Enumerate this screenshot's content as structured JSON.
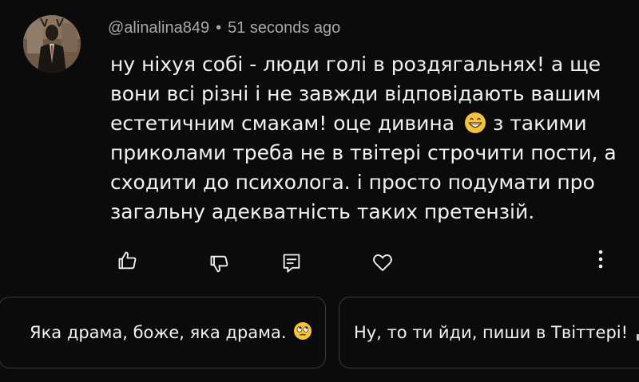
{
  "comment": {
    "username": "@alinalina849",
    "separator": "•",
    "time": "51 seconds ago",
    "lines": [
      "ну ніхуя собі - люди голі в роздягальнях! а ще",
      "вони всі різні і не завжди відповідають вашим",
      "естетичним смакам! оце дивина",
      "з такими",
      "приколами треба не в твітері строчити пости, а",
      "сходити до психолога. і просто подумати про",
      "загальну адекватність таких претензій."
    ],
    "emoji": "grinning-face-emoji"
  },
  "actions": {
    "like_icon": "thumbs-up-icon",
    "dislike_icon": "thumbs-down-icon",
    "reply_icon": "reply-comment-icon",
    "heart_icon": "heart-icon",
    "more_icon": "more-vertical-icon"
  },
  "suggestions": [
    {
      "text": "Яка драма, боже, яка драма.",
      "emoji": "face-with-rolling-eyes-emoji"
    },
    {
      "text": "Ну, то ти йди, пиши в Твіттері!",
      "emoji": "person-at-computer-emoji"
    }
  ],
  "colors": {
    "background": "#0b0b0b",
    "text": "#f2f2f2",
    "meta": "#a8a8a8",
    "card_border": "#3a3a3a"
  }
}
